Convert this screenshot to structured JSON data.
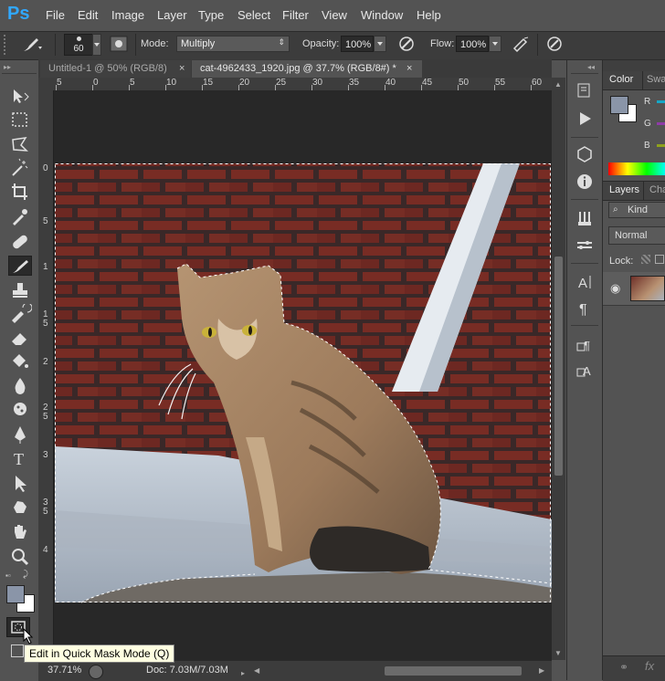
{
  "menubar": {
    "logo": "Ps",
    "items": [
      "File",
      "Edit",
      "Image",
      "Layer",
      "Type",
      "Select",
      "Filter",
      "View",
      "Window",
      "Help"
    ]
  },
  "options": {
    "brush_size": "60",
    "mode_label": "Mode:",
    "mode_value": "Multiply",
    "opacity_label": "Opacity:",
    "opacity_value": "100%",
    "flow_label": "Flow:",
    "flow_value": "100%"
  },
  "tabs": [
    {
      "label": "Untitled-1 @ 50% (RGB/8)",
      "active": false
    },
    {
      "label": "cat-4962433_1920.jpg @ 37.7% (RGB/8#) *",
      "active": true
    }
  ],
  "ruler_top": [
    "5",
    "0",
    "5",
    "10",
    "15",
    "20",
    "25",
    "30",
    "35",
    "40",
    "45",
    "50",
    "55",
    "60",
    "65"
  ],
  "ruler_left": [
    "0",
    "5",
    "1",
    "1",
    "5",
    "2",
    "2",
    "5",
    "3",
    "3",
    "5",
    "4"
  ],
  "status": {
    "zoom": "37.71%",
    "doc": "Doc: 7.03M/7.03M"
  },
  "tooltip": "Edit in Quick Mask Mode (Q)",
  "panels": {
    "color_tab": "Color",
    "swatches_tab": "Swa",
    "channels": [
      "R",
      "G",
      "B"
    ],
    "layers_tab": "Layers",
    "channels_tab": "Cha",
    "kind_label": "Kind",
    "blend_mode": "Normal",
    "lock_label": "Lock:"
  },
  "colors": {
    "foreground": "#8a95a8",
    "background": "#ffffff",
    "ps_blue": "#31a8ff"
  }
}
